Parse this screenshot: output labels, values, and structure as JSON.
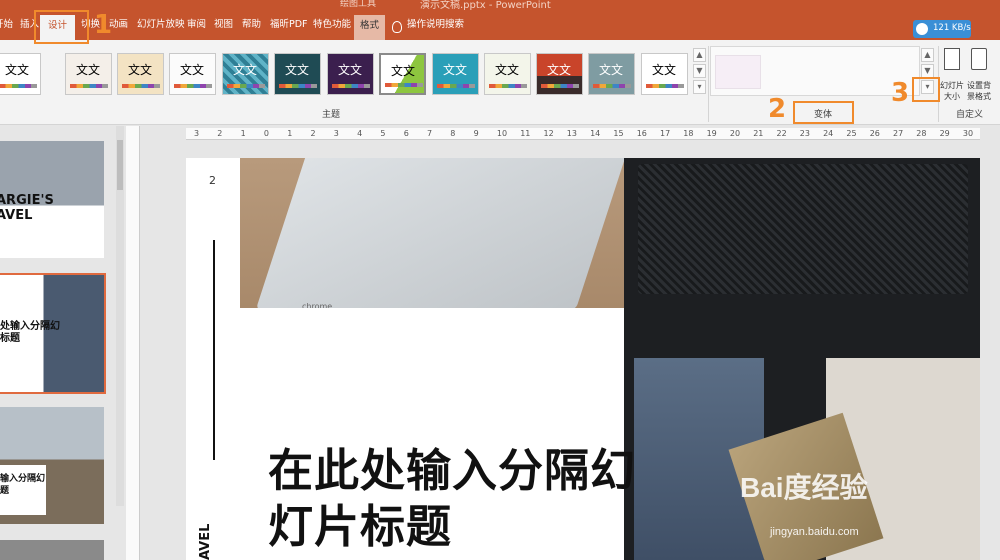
{
  "titlebar": {
    "tool_tab": "绘图工具",
    "doc_title": "演示文稿.pptx - PowerPoint"
  },
  "tabs": [
    {
      "label": "开始"
    },
    {
      "label": "插入"
    },
    {
      "label": "设计"
    },
    {
      "label": "切换"
    },
    {
      "label": "动画"
    },
    {
      "label": "幻灯片放映"
    },
    {
      "label": "审阅"
    },
    {
      "label": "视图"
    },
    {
      "label": "帮助"
    },
    {
      "label": "福昕PDF"
    },
    {
      "label": "特色功能"
    },
    {
      "label": "格式"
    }
  ],
  "search": {
    "label": "操作说明搜索"
  },
  "speed": {
    "label": "121 KB/s"
  },
  "ribbon": {
    "theme_label": "文文",
    "themes_group": "主题",
    "variants_group": "变体",
    "customize_group": "自定义",
    "slide_size": "幻灯片\n大小",
    "bg_format": "设置背\n景格式"
  },
  "annotations": {
    "n1": "1",
    "n2": "2",
    "n3": "3"
  },
  "ruler": {
    "ticks": [
      "3",
      "2",
      "1",
      "0",
      "1",
      "2",
      "3",
      "4",
      "5",
      "6",
      "7",
      "8",
      "9",
      "10",
      "11",
      "12",
      "13",
      "14",
      "15",
      "16",
      "17",
      "18",
      "19",
      "20",
      "21",
      "22",
      "23",
      "24",
      "25",
      "26",
      "27",
      "28",
      "29",
      "30"
    ]
  },
  "thumbs": {
    "t1_title": "ARGIE'S\nAVEL",
    "t2_title": "处输入分隔幻\n标题",
    "t3_title": "输入分隔幻\n题"
  },
  "slide": {
    "page": "2",
    "title_line1": "在此处输入分隔幻",
    "title_line2": "灯片标题",
    "vertical_text": "AVEL",
    "chrome_text": "chrome"
  },
  "watermark": {
    "logo": "Bai度经验",
    "url": "jingyan.baidu.com"
  },
  "colors": {
    "accent": "#c5542d",
    "annotation": "#f08a2c"
  }
}
